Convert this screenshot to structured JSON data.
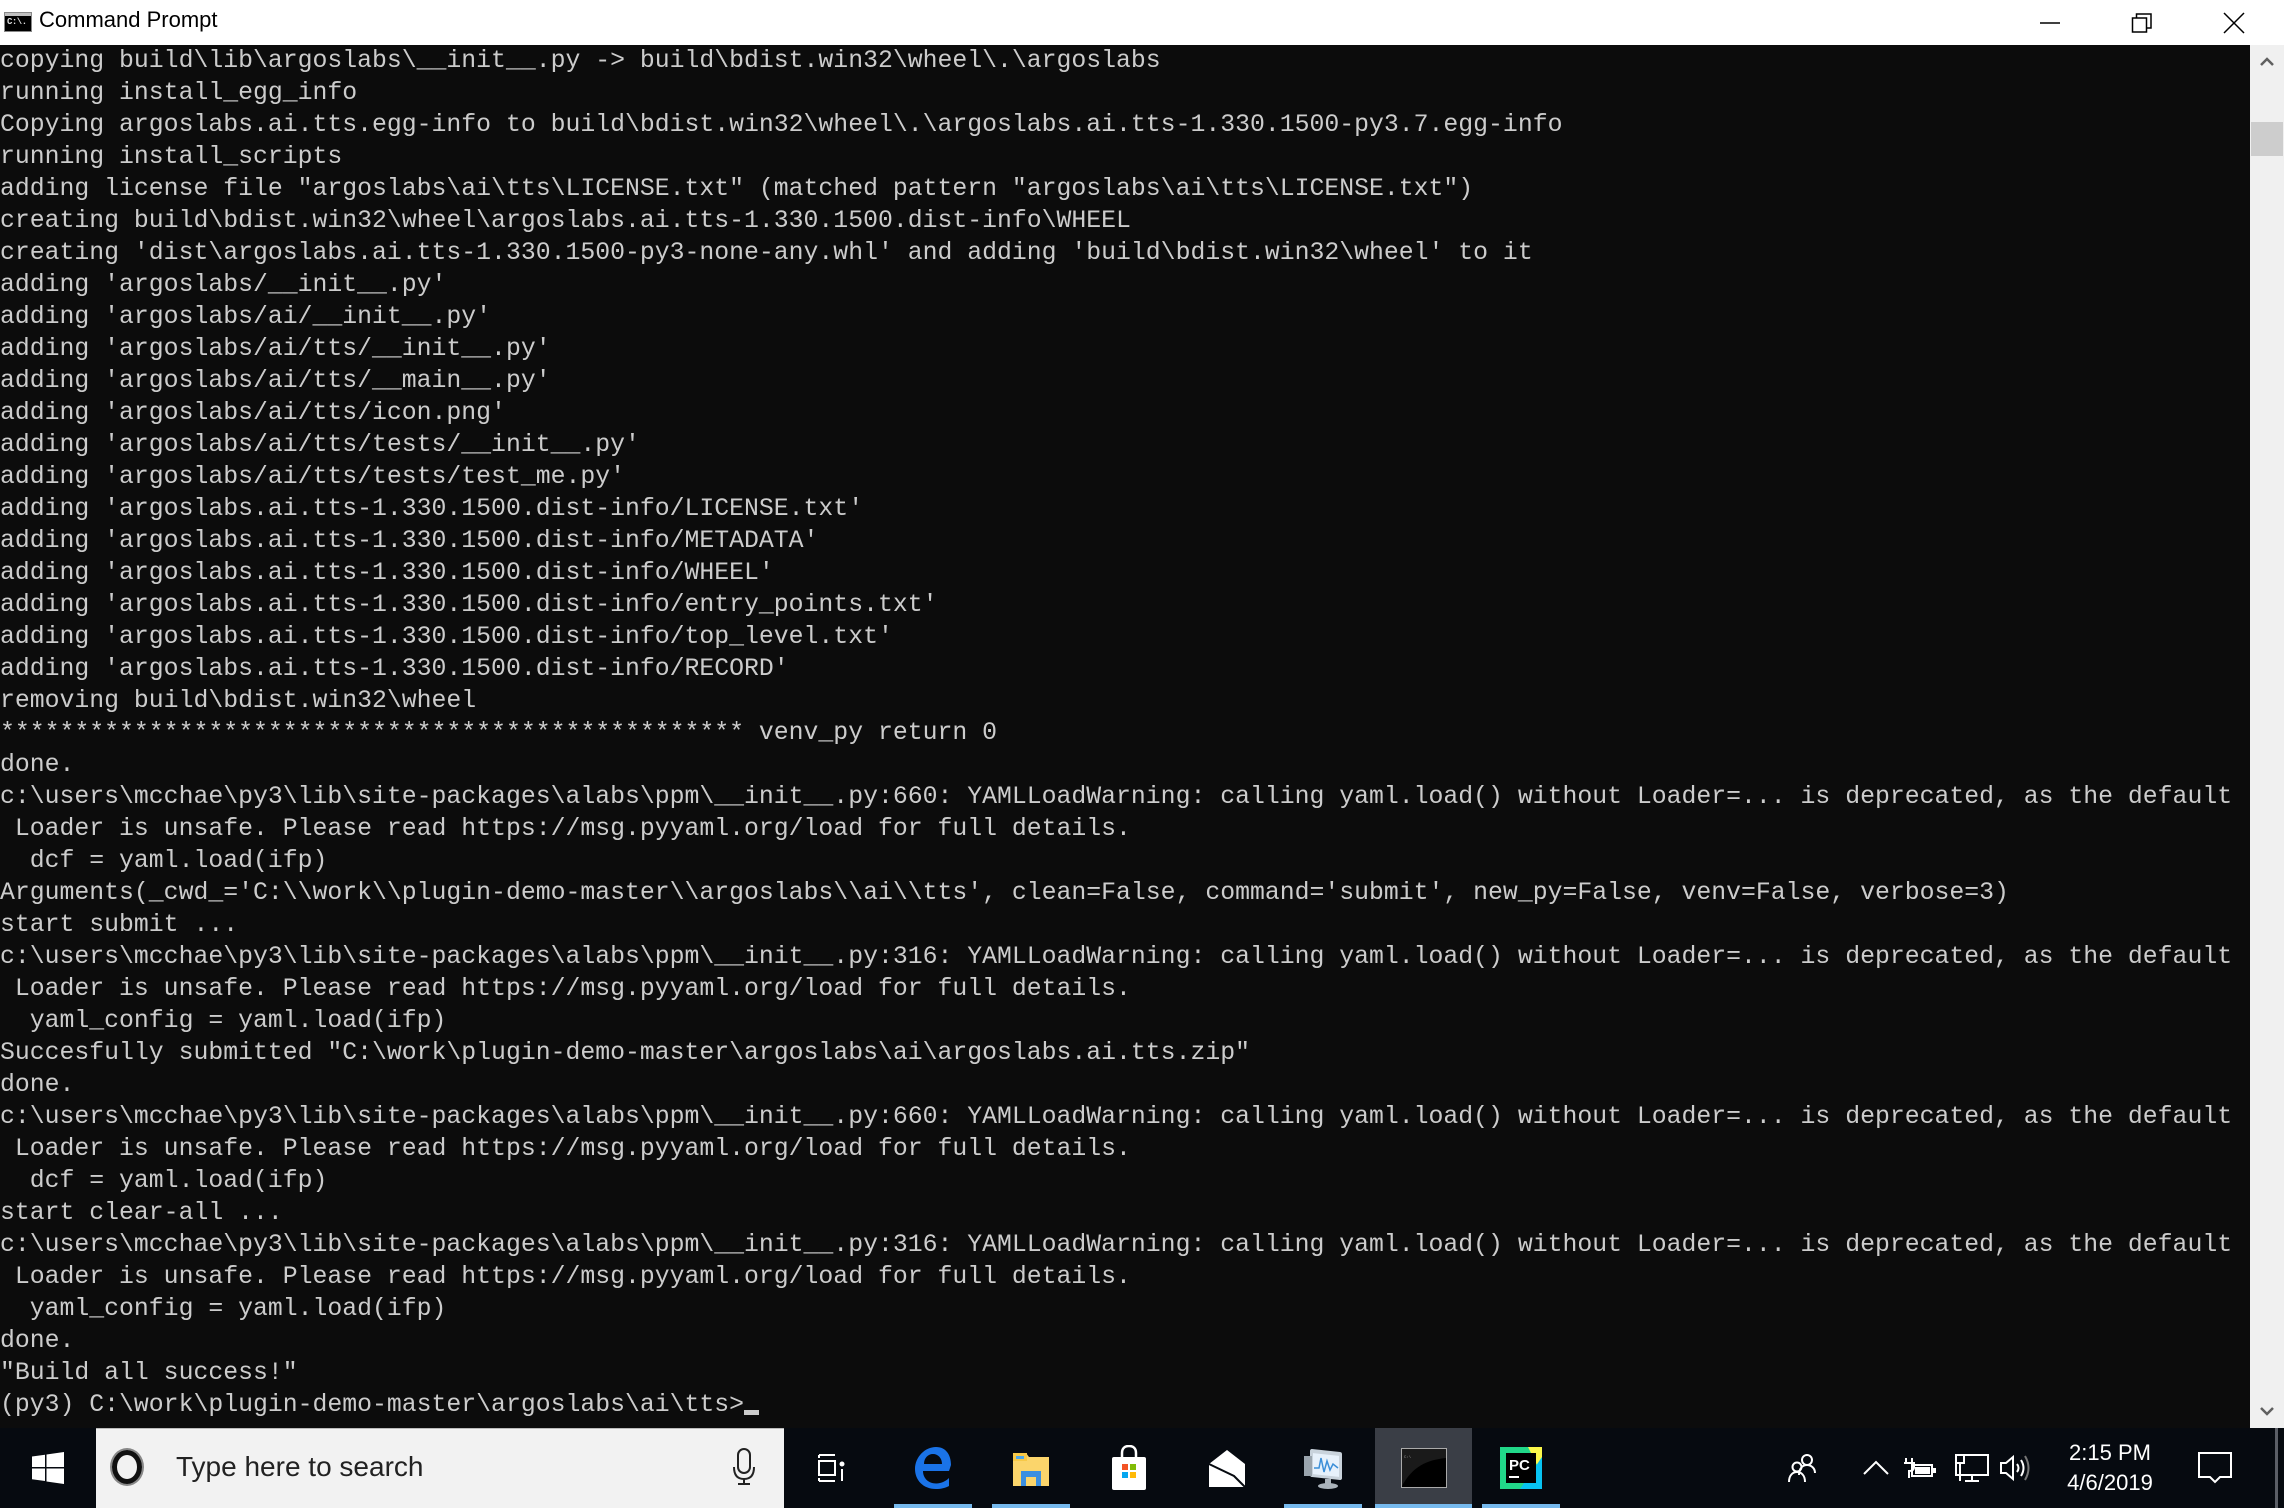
{
  "window": {
    "title": "Command Prompt",
    "icon": "cmd-icon",
    "icon_glyph": "C:\\.",
    "controls": [
      "minimize",
      "restore",
      "close"
    ]
  },
  "console": {
    "lines": [
      "copying build\\lib\\argoslabs\\__init__.py -> build\\bdist.win32\\wheel\\.\\argoslabs",
      "running install_egg_info",
      "Copying argoslabs.ai.tts.egg-info to build\\bdist.win32\\wheel\\.\\argoslabs.ai.tts-1.330.1500-py3.7.egg-info",
      "running install_scripts",
      "adding license file \"argoslabs\\ai\\tts\\LICENSE.txt\" (matched pattern \"argoslabs\\ai\\tts\\LICENSE.txt\")",
      "creating build\\bdist.win32\\wheel\\argoslabs.ai.tts-1.330.1500.dist-info\\WHEEL",
      "creating 'dist\\argoslabs.ai.tts-1.330.1500-py3-none-any.whl' and adding 'build\\bdist.win32\\wheel' to it",
      "adding 'argoslabs/__init__.py'",
      "adding 'argoslabs/ai/__init__.py'",
      "adding 'argoslabs/ai/tts/__init__.py'",
      "adding 'argoslabs/ai/tts/__main__.py'",
      "adding 'argoslabs/ai/tts/icon.png'",
      "adding 'argoslabs/ai/tts/tests/__init__.py'",
      "adding 'argoslabs/ai/tts/tests/test_me.py'",
      "adding 'argoslabs.ai.tts-1.330.1500.dist-info/LICENSE.txt'",
      "adding 'argoslabs.ai.tts-1.330.1500.dist-info/METADATA'",
      "adding 'argoslabs.ai.tts-1.330.1500.dist-info/WHEEL'",
      "adding 'argoslabs.ai.tts-1.330.1500.dist-info/entry_points.txt'",
      "adding 'argoslabs.ai.tts-1.330.1500.dist-info/top_level.txt'",
      "adding 'argoslabs.ai.tts-1.330.1500.dist-info/RECORD'",
      "removing build\\bdist.win32\\wheel",
      "************************************************** venv_py return 0",
      "done.",
      "c:\\users\\mcchae\\py3\\lib\\site-packages\\alabs\\ppm\\__init__.py:660: YAMLLoadWarning: calling yaml.load() without Loader=... is deprecated, as the default",
      " Loader is unsafe. Please read https://msg.pyyaml.org/load for full details.",
      "  dcf = yaml.load(ifp)",
      "Arguments(_cwd_='C:\\\\work\\\\plugin-demo-master\\\\argoslabs\\\\ai\\\\tts', clean=False, command='submit', new_py=False, venv=False, verbose=3)",
      "start submit ...",
      "c:\\users\\mcchae\\py3\\lib\\site-packages\\alabs\\ppm\\__init__.py:316: YAMLLoadWarning: calling yaml.load() without Loader=... is deprecated, as the default",
      " Loader is unsafe. Please read https://msg.pyyaml.org/load for full details.",
      "  yaml_config = yaml.load(ifp)",
      "Succesfully submitted \"C:\\work\\plugin-demo-master\\argoslabs\\ai\\argoslabs.ai.tts.zip\"",
      "done.",
      "c:\\users\\mcchae\\py3\\lib\\site-packages\\alabs\\ppm\\__init__.py:660: YAMLLoadWarning: calling yaml.load() without Loader=... is deprecated, as the default",
      " Loader is unsafe. Please read https://msg.pyyaml.org/load for full details.",
      "  dcf = yaml.load(ifp)",
      "start clear-all ...",
      "c:\\users\\mcchae\\py3\\lib\\site-packages\\alabs\\ppm\\__init__.py:316: YAMLLoadWarning: calling yaml.load() without Loader=... is deprecated, as the default",
      " Loader is unsafe. Please read https://msg.pyyaml.org/load for full details.",
      "  yaml_config = yaml.load(ifp)",
      "done.",
      "\"Build all success!\""
    ],
    "prompt": "(py3) C:\\work\\plugin-demo-master\\argoslabs\\ai\\tts>",
    "input_value": ""
  },
  "taskbar": {
    "start_icon": "windows-logo-icon",
    "search_placeholder": "Type here to search",
    "pinned": [
      {
        "name": "task-view",
        "icon": "task-view-icon",
        "running": false,
        "active": false
      },
      {
        "name": "edge",
        "icon": "edge-icon",
        "running": true,
        "active": false
      },
      {
        "name": "file-explorer",
        "icon": "folder-icon",
        "running": true,
        "active": false
      },
      {
        "name": "store",
        "icon": "store-bag-icon",
        "running": false,
        "active": false
      },
      {
        "name": "mail",
        "icon": "mail-icon",
        "running": false,
        "active": false
      },
      {
        "name": "performance-monitor",
        "icon": "perfmon-icon",
        "running": true,
        "active": false
      },
      {
        "name": "command-prompt",
        "icon": "cmd-icon",
        "running": true,
        "active": true
      },
      {
        "name": "pycharm",
        "icon": "pycharm-icon",
        "running": true,
        "active": false
      }
    ],
    "pycharm_label": "PC",
    "tray": {
      "icons": [
        "people-icon",
        "show-hidden-icon",
        "battery-charging-icon",
        "network-icon",
        "volume-icon",
        "notifications-icon"
      ],
      "time": "2:15 PM",
      "date": "4/6/2019"
    }
  }
}
